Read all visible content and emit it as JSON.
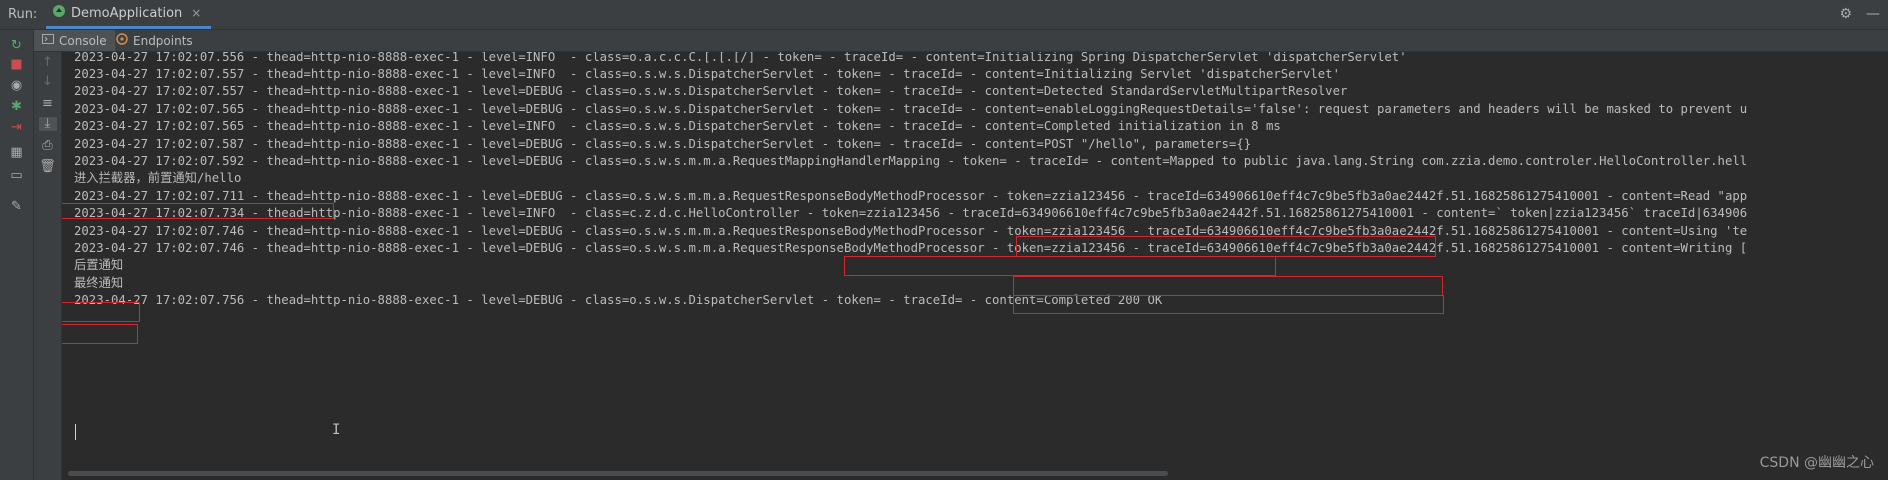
{
  "run_bar": {
    "label": "Run:",
    "tab": {
      "title": "DemoApplication",
      "close": "×"
    }
  },
  "subtabs": [
    {
      "label": "Console"
    },
    {
      "label": "Endpoints"
    }
  ],
  "console_lines": [
    "2023-04-27 17:02:07.556 - thead=http-nio-8888-exec-1 - level=INFO  - class=o.a.c.c.C.[.[.[/] - token= - traceId= - content=Initializing Spring DispatcherServlet 'dispatcherServlet'",
    "2023-04-27 17:02:07.557 - thead=http-nio-8888-exec-1 - level=INFO  - class=o.s.w.s.DispatcherServlet - token= - traceId= - content=Initializing Servlet 'dispatcherServlet'",
    "2023-04-27 17:02:07.557 - thead=http-nio-8888-exec-1 - level=DEBUG - class=o.s.w.s.DispatcherServlet - token= - traceId= - content=Detected StandardServletMultipartResolver",
    "2023-04-27 17:02:07.565 - thead=http-nio-8888-exec-1 - level=DEBUG - class=o.s.w.s.DispatcherServlet - token= - traceId= - content=enableLoggingRequestDetails='false': request parameters and headers will be masked to prevent u",
    "2023-04-27 17:02:07.565 - thead=http-nio-8888-exec-1 - level=INFO  - class=o.s.w.s.DispatcherServlet - token= - traceId= - content=Completed initialization in 8 ms",
    "2023-04-27 17:02:07.587 - thead=http-nio-8888-exec-1 - level=DEBUG - class=o.s.w.s.DispatcherServlet - token= - traceId= - content=POST \"/hello\", parameters={}",
    "2023-04-27 17:02:07.592 - thead=http-nio-8888-exec-1 - level=DEBUG - class=o.s.w.s.m.m.a.RequestMappingHandlerMapping - token= - traceId= - content=Mapped to public java.lang.String com.zzia.demo.controler.HelloController.hell",
    "进入拦截器，前置通知/hello",
    "2023-04-27 17:02:07.711 - thead=http-nio-8888-exec-1 - level=DEBUG - class=o.s.w.s.m.m.a.RequestResponseBodyMethodProcessor - token=zzia123456 - traceId=634906610eff4c7c9be5fb3a0ae2442f.51.16825861275410001 - content=Read \"app",
    "2023-04-27 17:02:07.734 - thead=http-nio-8888-exec-1 - level=INFO  - class=c.z.d.c.HelloController - token=zzia123456 - traceId=634906610eff4c7c9be5fb3a0ae2442f.51.16825861275410001 - content=` token|zzia123456` traceId|634906",
    "2023-04-27 17:02:07.746 - thead=http-nio-8888-exec-1 - level=DEBUG - class=o.s.w.s.m.m.a.RequestResponseBodyMethodProcessor - token=zzia123456 - traceId=634906610eff4c7c9be5fb3a0ae2442f.51.16825861275410001 - content=Using 'te",
    "2023-04-27 17:02:07.746 - thead=http-nio-8888-exec-1 - level=DEBUG - class=o.s.w.s.m.m.a.RequestResponseBodyMethodProcessor - token=zzia123456 - traceId=634906610eff4c7c9be5fb3a0ae2442f.51.16825861275410001 - content=Writing [",
    "后置通知",
    "最终通知",
    "2023-04-27 17:02:07.756 - thead=http-nio-8888-exec-1 - level=DEBUG - class=o.s.w.s.DispatcherServlet - token= - traceId= - content=Completed 200 OK"
  ],
  "watermark": "CSDN @幽幽之心",
  "colors": {
    "background": "#2b2b2b",
    "toolbar": "#3c3f41",
    "text": "#bbbbbb",
    "highlight_box": "#d0282e",
    "run_green": "#59a869",
    "stop_red": "#c94f4f"
  },
  "icons": {
    "rerun": "rerun-icon",
    "stop": "stop-icon",
    "settings": "gear-icon",
    "minimize": "minimize-icon"
  }
}
